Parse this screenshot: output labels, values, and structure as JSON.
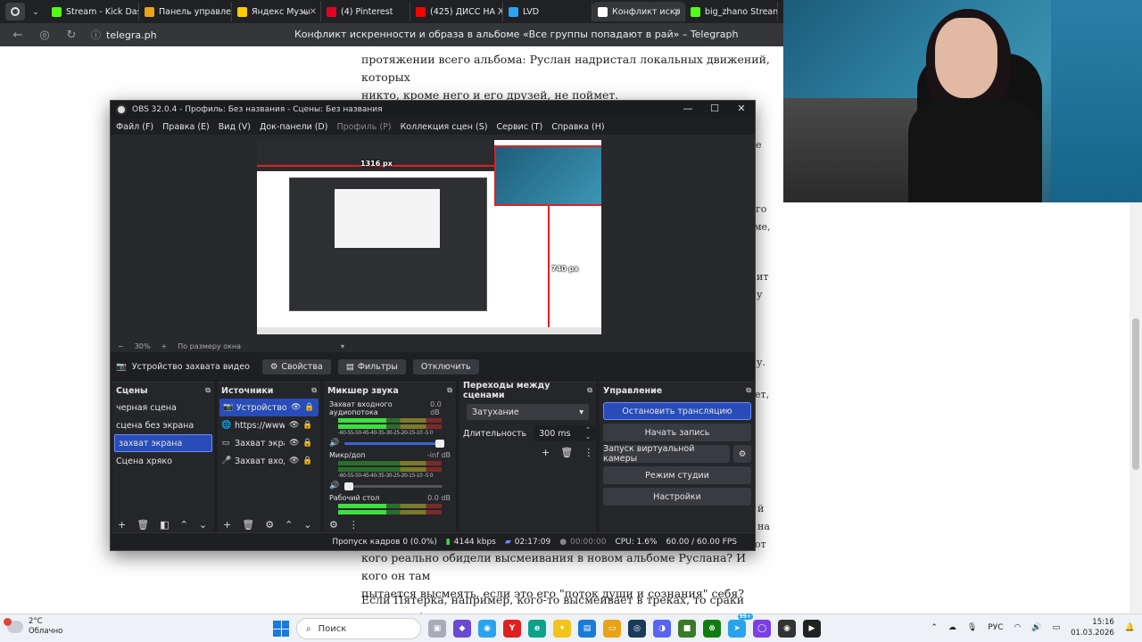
{
  "browser": {
    "tabs": [
      {
        "label": "Stream - Kick Dash",
        "color": "#53fc18",
        "active": false,
        "audio": false
      },
      {
        "label": "Панель управлен",
        "color": "#e8a317",
        "active": false,
        "audio": false
      },
      {
        "label": "Яндекс Музы",
        "color": "#ffcc00",
        "active": false,
        "audio": true
      },
      {
        "label": "(4) Pinterest",
        "color": "#e60023",
        "active": false,
        "audio": false
      },
      {
        "label": "(425) ДИСС НА Ж",
        "color": "#ff0000",
        "active": false,
        "audio": false
      },
      {
        "label": "LVD",
        "color": "#2aa3ef",
        "active": false,
        "audio": false
      },
      {
        "label": "Конфликт искр",
        "color": "#ffffff",
        "active": true,
        "audio": false
      },
      {
        "label": "big_zhano Stream",
        "color": "#53fc18",
        "active": false,
        "audio": false
      }
    ],
    "site": "telegra.ph",
    "page_title": "Конфликт искренности и образа в альбоме «Все группы попадают в рай» – Telegraph"
  },
  "article": {
    "top_lines": [
      "протяжении всего альбома: Руслан надристал локальных движений, которых",
      "никто, кроме него и его друзей, не поймет."
    ],
    "bottom_lines": [
      "кого реально обидели высмеивания в новом альбоме Руслана? И кого он там",
      "пытается высмеять, если это его \"поток души и сознания\" себя?"
    ],
    "last_line": "Если Пятерка, например, кого-то высмеивает в треках, то сраки успешно будут",
    "stray_right": [
      "е",
      "го",
      "ме,",
      "ит",
      "у",
      "у.",
      "ет,",
      "й",
      "на",
      "от"
    ]
  },
  "obs": {
    "title": "OBS 32.0.4 - Профиль: Без названия - Сцены: Без названия",
    "menu": [
      {
        "label": "Файл (F)",
        "disabled": false
      },
      {
        "label": "Правка (E)",
        "disabled": false
      },
      {
        "label": "Вид (V)",
        "disabled": false
      },
      {
        "label": "Док-панели (D)",
        "disabled": false
      },
      {
        "label": "Профиль (P)",
        "disabled": true
      },
      {
        "label": "Коллекция сцен (S)",
        "disabled": false
      },
      {
        "label": "Сервис (T)",
        "disabled": false
      },
      {
        "label": "Справка (H)",
        "disabled": false
      }
    ],
    "preview": {
      "label_width": "1316 px",
      "label_height": "740 px",
      "zoom": "30%",
      "fit_mode": "По размеру окна"
    },
    "source_bar": {
      "source_name": "Устройство захвата видео",
      "properties": "Свойства",
      "filters": "Фильтры",
      "disable": "Отключить"
    },
    "scenes": {
      "title": "Сцены",
      "items": [
        {
          "label": "черная сцена",
          "selected": false
        },
        {
          "label": "сцена без экрана",
          "selected": false
        },
        {
          "label": "захват экрана",
          "selected": true
        },
        {
          "label": "Сцена хряко",
          "selected": false
        }
      ]
    },
    "sources": {
      "title": "Источники",
      "items": [
        {
          "label": "Устройство з",
          "icon": "camera-icon",
          "glyph": "📷",
          "selected": true
        },
        {
          "label": "https://www.c",
          "icon": "globe-icon",
          "glyph": "🌐",
          "selected": false
        },
        {
          "label": "Захват экран",
          "icon": "monitor-icon",
          "glyph": "▭",
          "selected": false
        },
        {
          "label": "Захват входн",
          "icon": "microphone-icon",
          "glyph": "🎤",
          "selected": false
        }
      ]
    },
    "mixer": {
      "title": "Микшер звука",
      "scale": "-60-55-50-45-40-35-30-25-20-15-10 -5  0",
      "channels": [
        {
          "name": "Захват входного аудиопотока",
          "db": "0.0 dB",
          "lit": true,
          "zero": false
        },
        {
          "name": "Микр/доп",
          "db": "-inf dB",
          "lit": false,
          "zero": true
        },
        {
          "name": "Рабочий стол",
          "db": "0.0 dB",
          "lit": true,
          "zero": false
        }
      ]
    },
    "transitions": {
      "title": "Переходы между сценами",
      "type": "Затухание",
      "duration_label": "Длительность",
      "duration": "300 ms"
    },
    "controls": {
      "title": "Управление",
      "stop_stream": "Остановить трансляцию",
      "start_record": "Начать запись",
      "virtual_cam": "Запуск виртуальной камеры",
      "studio_mode": "Режим студии",
      "settings": "Настройки"
    },
    "status": {
      "dropped": "Пропуск кадров 0 (0.0%)",
      "bitrate": "4144 kbps",
      "stream_time": "02:17:09",
      "rec_time": "00:00:00",
      "cpu": "CPU: 1.6%",
      "fps": "60.00 / 60.00 FPS"
    }
  },
  "taskbar": {
    "temp": "2°C",
    "weather": "Облачно",
    "search": "Поиск",
    "badge": "99+",
    "lang": "РУС",
    "time": "15:16",
    "date": "01.03.2026"
  },
  "colors": {
    "obs_selected": "#284cb8",
    "obs_bg": "#1e1f22",
    "accent_red": "#e02020"
  }
}
